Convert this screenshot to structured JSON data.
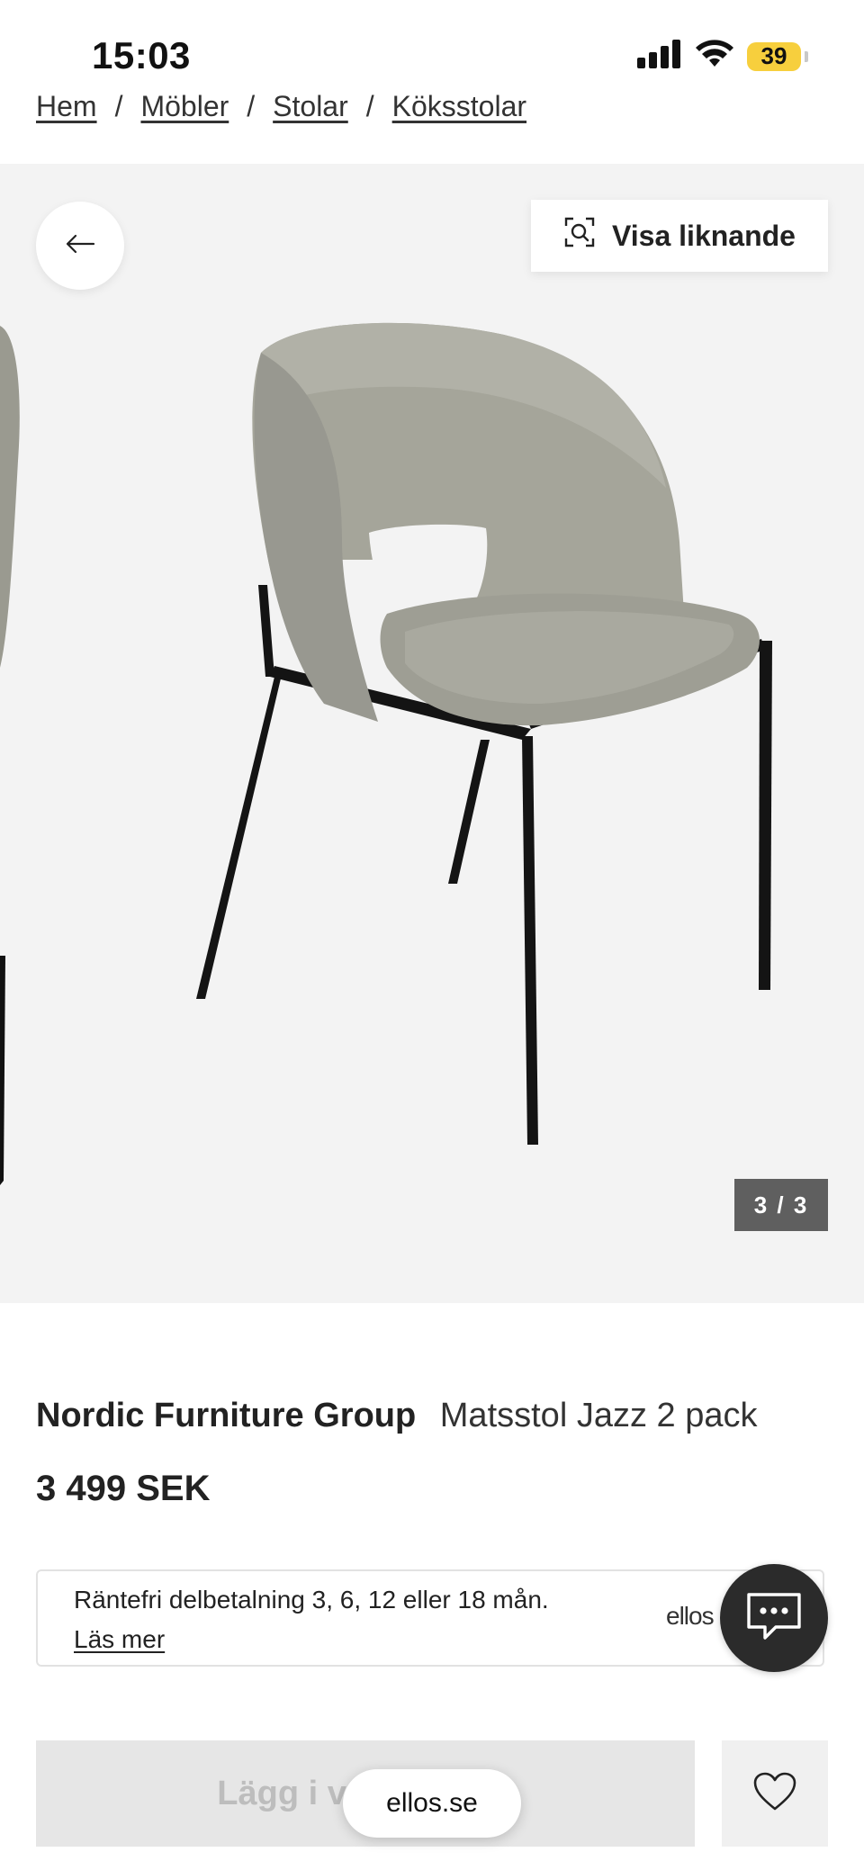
{
  "status_bar": {
    "time": "15:03",
    "battery": "39",
    "battery_color": "#f7cf3d"
  },
  "breadcrumb": [
    {
      "label": "Hem"
    },
    {
      "label": "Möbler"
    },
    {
      "label": "Stolar"
    },
    {
      "label": "Köksstolar"
    }
  ],
  "gallery": {
    "similar_label": "Visa liknande",
    "counter": "3 / 3",
    "current_image": 3,
    "total_images": 3
  },
  "product": {
    "brand": "Nordic Furniture Group",
    "name": "Matsstol Jazz 2 pack",
    "price": "3 499 SEK"
  },
  "finance": {
    "text": "Räntefri delbetalning 3, 6, 12 eller 18 mån.",
    "link": "Läs mer",
    "logo": "ellos"
  },
  "actions": {
    "cart_label": "Lägg i varukorgen"
  },
  "browser": {
    "url": "ellos.se"
  },
  "colors": {
    "gallery_bg": "#f3f3f3",
    "counter_bg": "#5f5f5f",
    "chat_bg": "#2b2b2b"
  }
}
